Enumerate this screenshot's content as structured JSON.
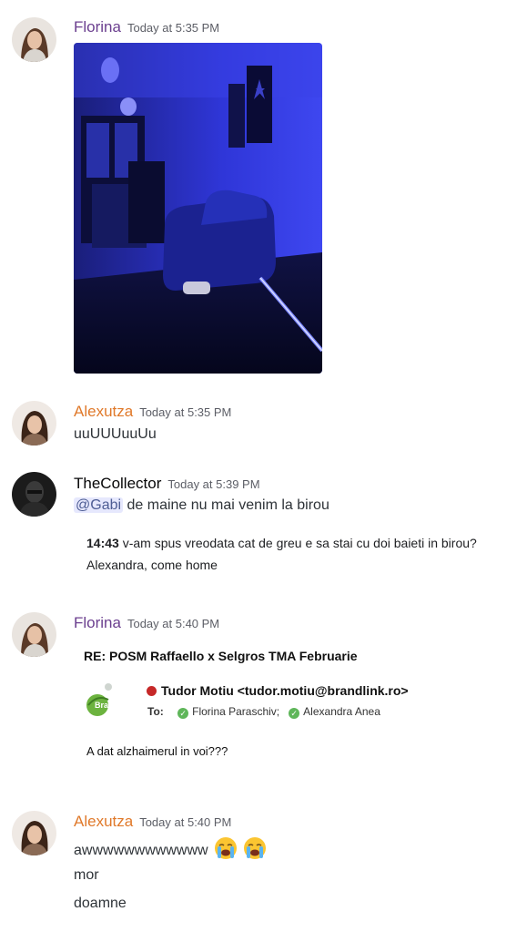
{
  "messages": [
    {
      "author": "Florina",
      "timestamp": "Today at 5:35 PM",
      "attachment": "photo-room-blue-light"
    },
    {
      "author": "Alexutza",
      "timestamp": "Today at 5:35 PM",
      "text": "uuUUUuuUu"
    },
    {
      "author": "TheCollector",
      "timestamp": "Today at 5:39 PM",
      "mention": "@Gabi",
      "text": "de maine nu mai venim la birou",
      "quote_time": "14:43",
      "quote_text": "v-am spus vreodata cat de greu e sa stai cu doi baieti in birou?",
      "quote_line2": "Alexandra, come home"
    },
    {
      "author": "Florina",
      "timestamp": "Today at 5:40 PM",
      "email": {
        "subject": "RE: POSM Raffaello x Selgros TMA Februarie",
        "logo_text": "Brand",
        "from": "Tudor Motiu <tudor.motiu@brandlink.ro>",
        "to_label": "To:",
        "recipients": [
          "Florina Paraschiv;",
          "Alexandra Anea"
        ],
        "body": "A dat alzhaimerul in voi???"
      }
    },
    {
      "author": "Alexutza",
      "timestamp": "Today at 5:40 PM",
      "lines": [
        "awwwwwwwwwwww",
        "mor",
        "doamne"
      ],
      "emoji": [
        "loudly-crying-face-emoji",
        "loudly-crying-face-emoji"
      ]
    }
  ],
  "colors": {
    "florina": "#6b3f8f",
    "alexutza": "#e0792a",
    "thecollector": "#060607",
    "mention_bg": "#e6e8fd",
    "photo_blue": "#2a2fd6"
  }
}
